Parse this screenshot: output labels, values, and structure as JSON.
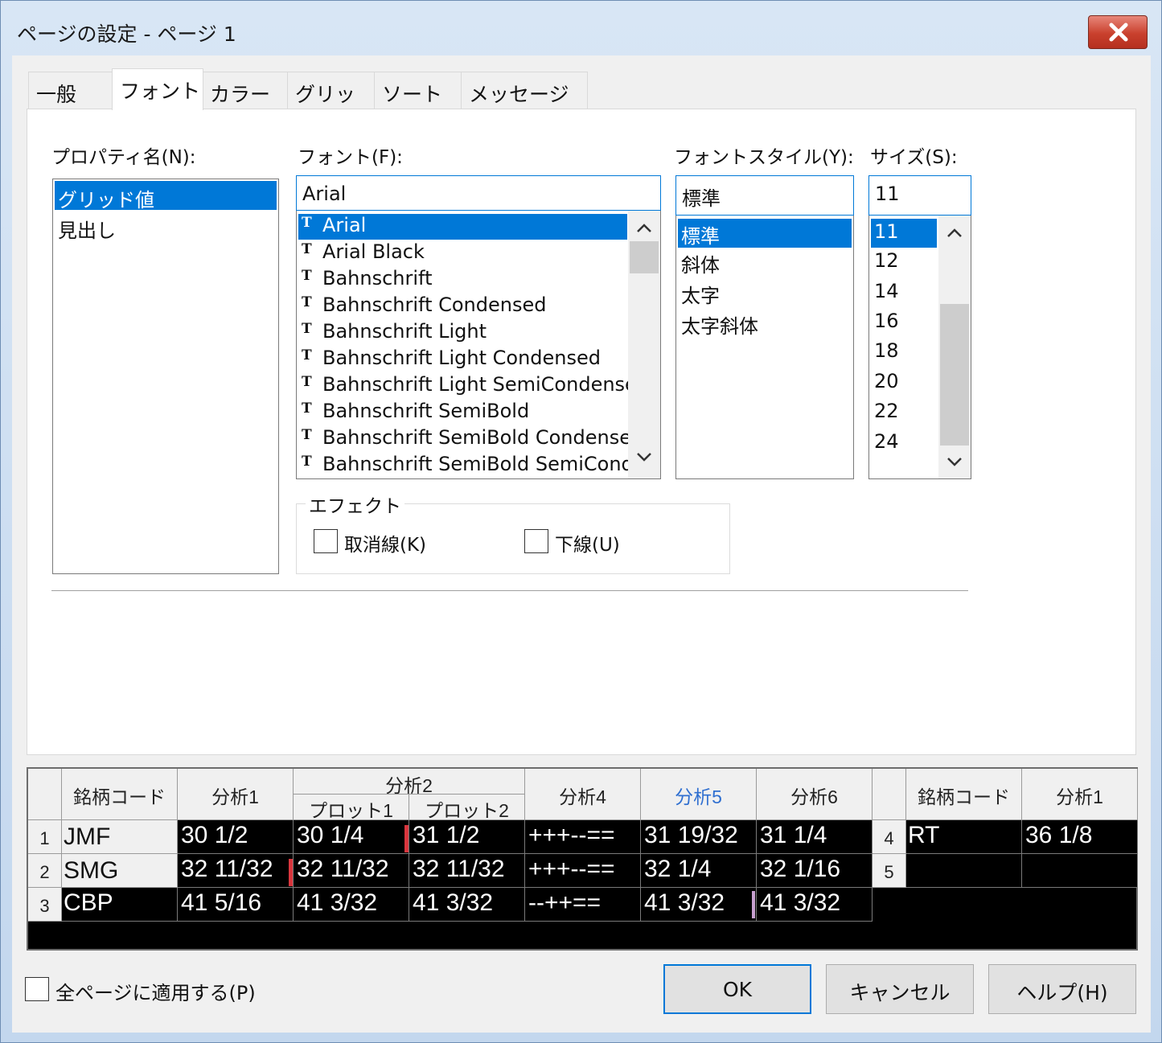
{
  "window": {
    "title": "ページの設定 - ページ 1",
    "close_label": "✕"
  },
  "tabs": [
    {
      "label": "一般"
    },
    {
      "label": "フォント"
    },
    {
      "label": "カラー"
    },
    {
      "label": "グリッド"
    },
    {
      "label": "ソート"
    },
    {
      "label": "メッセージング"
    }
  ],
  "font_tab": {
    "property_label": "プロパティ名(N):",
    "properties": [
      "グリッド値",
      "見出し"
    ],
    "font_label": "フォント(F):",
    "font_value": "Arial",
    "fonts": [
      "Arial",
      "Arial Black",
      "Bahnschrift",
      "Bahnschrift Condensed",
      "Bahnschrift Light",
      "Bahnschrift Light Condensed",
      "Bahnschrift Light SemiCondense",
      "Bahnschrift SemiBold",
      "Bahnschrift SemiBold Condense",
      "Bahnschrift SemiBold SemiCond"
    ],
    "style_label": "フォントスタイル(Y):",
    "style_value": "標準",
    "styles": [
      "標準",
      "斜体",
      "太字",
      "太字斜体"
    ],
    "size_label": "サイズ(S):",
    "size_value": "11",
    "sizes": [
      "11",
      "12",
      "14",
      "16",
      "18",
      "20",
      "22",
      "24"
    ],
    "effects_label": "エフェクト",
    "strike_label": "取消線(K)",
    "underline_label": "下線(U)"
  },
  "preview": {
    "headers": {
      "code": "銘柄コード",
      "a1": "分析1",
      "a2": "分析2",
      "plot1": "プロット1",
      "plot2": "プロット2",
      "a4": "分析4",
      "a5": "分析5",
      "a6": "分析6",
      "code_r": "銘柄コード",
      "a1_r": "分析1"
    },
    "rows": [
      {
        "n": "1",
        "code": "JMF",
        "a1": "30  1/2",
        "p1": "30  1/4",
        "p2": "31  1/2",
        "a4": "+++--==",
        "a5": "31  19/32",
        "a6": "31  1/4"
      },
      {
        "n": "2",
        "code": "SMG",
        "a1": "32  11/32",
        "p1": "32  11/32",
        "p2": "32  11/32",
        "a4": "+++--==",
        "a5": "32  1/4",
        "a6": "32  1/16"
      },
      {
        "n": "3",
        "code": "CBP",
        "a1": "41  5/16",
        "p1": "41  3/32",
        "p2": "41  3/32",
        "a4": "--++==",
        "a5": "41  3/32",
        "a6": "41  3/32"
      }
    ],
    "rows_r": [
      {
        "n": "4",
        "code": "RT",
        "a1": "36  1/8"
      },
      {
        "n": "5",
        "code": "",
        "a1": ""
      }
    ],
    "colors": {
      "a5_header": "#2f6fd0",
      "marker": "#d9363e"
    }
  },
  "footer": {
    "apply_all_label": "全ページに適用する(P)",
    "ok": "OK",
    "cancel": "キャンセル",
    "help": "ヘルプ(H)"
  }
}
